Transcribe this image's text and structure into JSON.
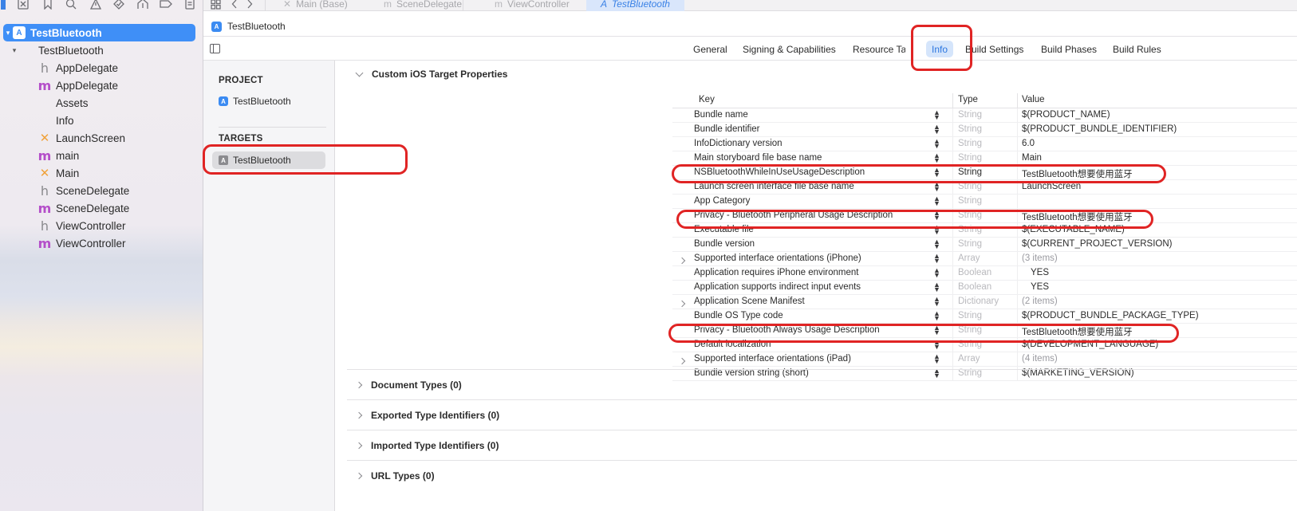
{
  "colors": {
    "accent": "#3f8ff7",
    "annotation": "#e02424",
    "selected_tab_bg": "#d5e5fb"
  },
  "navigator": {
    "toolbar_icons": [
      "project-navigator-icon",
      "source-control-icon",
      "bookmark-icon",
      "find-icon",
      "issue-icon",
      "test-icon",
      "debug-icon",
      "breakpoint-icon",
      "report-icon"
    ],
    "tree": [
      {
        "label": "TestBluetooth",
        "type": "proj",
        "glyph": "A",
        "level": 0,
        "disclosure": "▾",
        "selected": true
      },
      {
        "label": "TestBluetooth",
        "type": "folder",
        "glyph": "",
        "level": 1,
        "disclosure": "▾",
        "selected": false
      },
      {
        "label": "AppDelegate",
        "type": "h",
        "glyph": "h",
        "level": 2,
        "disclosure": "",
        "selected": false
      },
      {
        "label": "AppDelegate",
        "type": "m",
        "glyph": "m",
        "level": 2,
        "disclosure": "",
        "selected": false
      },
      {
        "label": "Assets",
        "type": "assets",
        "glyph": "",
        "level": 2,
        "disclosure": "",
        "selected": false
      },
      {
        "label": "Info",
        "type": "plist",
        "glyph": "",
        "level": 2,
        "disclosure": "",
        "selected": false
      },
      {
        "label": "LaunchScreen",
        "type": "xib",
        "glyph": "✕",
        "level": 2,
        "disclosure": "",
        "selected": false
      },
      {
        "label": "main",
        "type": "m",
        "glyph": "m",
        "level": 2,
        "disclosure": "",
        "selected": false
      },
      {
        "label": "Main",
        "type": "xib",
        "glyph": "✕",
        "level": 2,
        "disclosure": "",
        "selected": false
      },
      {
        "label": "SceneDelegate",
        "type": "h",
        "glyph": "h",
        "level": 2,
        "disclosure": "",
        "selected": false
      },
      {
        "label": "SceneDelegate",
        "type": "m",
        "glyph": "m",
        "level": 2,
        "disclosure": "",
        "selected": false
      },
      {
        "label": "ViewController",
        "type": "h",
        "glyph": "h",
        "level": 2,
        "disclosure": "",
        "selected": false
      },
      {
        "label": "ViewController",
        "type": "m",
        "glyph": "m",
        "level": 2,
        "disclosure": "",
        "selected": false
      }
    ]
  },
  "editor_tabs": [
    {
      "label": "Main (Base)",
      "glyph": "✕",
      "active": false
    },
    {
      "label": "SceneDelegate",
      "glyph": "m",
      "active": false
    },
    {
      "label": "ViewController",
      "glyph": "m",
      "active": false
    },
    {
      "label": "TestBluetooth",
      "glyph": "A",
      "active": true
    }
  ],
  "breadcrumb": {
    "label": "TestBluetooth",
    "glyph": "A"
  },
  "top_tabs": [
    {
      "label": "General",
      "active": false
    },
    {
      "label": "Signing & Capabilities",
      "active": false
    },
    {
      "label": "Resource Tags",
      "active": false
    },
    {
      "label": "Info",
      "active": true
    },
    {
      "label": "Build Settings",
      "active": false
    },
    {
      "label": "Build Phases",
      "active": false
    },
    {
      "label": "Build Rules",
      "active": false
    }
  ],
  "sidebar": {
    "project_heading": "PROJECT",
    "project_item": "TestBluetooth",
    "project_glyph": "A",
    "targets_heading": "TARGETS",
    "target_item": "TestBluetooth",
    "target_glyph": "A"
  },
  "custom_properties": {
    "title": "Custom iOS Target Properties",
    "columns": {
      "key": "Key",
      "type": "Type",
      "value": "Value"
    },
    "rows": [
      {
        "key": "Bundle name",
        "type": "String",
        "value": "$(PRODUCT_NAME)",
        "expandable": false
      },
      {
        "key": "Bundle identifier",
        "type": "String",
        "value": "$(PRODUCT_BUNDLE_IDENTIFIER)",
        "expandable": false
      },
      {
        "key": "InfoDictionary version",
        "type": "String",
        "value": "6.0",
        "expandable": false
      },
      {
        "key": "Main storyboard file base name",
        "type": "String",
        "value": "Main",
        "expandable": false
      },
      {
        "key": "NSBluetoothWhileInUseUsageDescription",
        "type": "String",
        "value": "TestBluetooth想要使用蓝牙",
        "expandable": false,
        "type_strong": true
      },
      {
        "key": "Launch screen interface file base name",
        "type": "String",
        "value": "LaunchScreen",
        "expandable": false
      },
      {
        "key": "App Category",
        "type": "String",
        "value": "",
        "expandable": false,
        "value_stepper": true
      },
      {
        "key": "Privacy - Bluetooth Peripheral Usage Description",
        "type": "String",
        "value": "TestBluetooth想要使用蓝牙",
        "expandable": false
      },
      {
        "key": "Executable file",
        "type": "String",
        "value": "$(EXECUTABLE_NAME)",
        "expandable": false
      },
      {
        "key": "Bundle version",
        "type": "String",
        "value": "$(CURRENT_PROJECT_VERSION)",
        "expandable": false
      },
      {
        "key": "Supported interface orientations (iPhone)",
        "type": "Array",
        "value": "(3 items)",
        "expandable": true,
        "value_muted": true
      },
      {
        "key": "Application requires iPhone environment",
        "type": "Boolean",
        "value": "YES",
        "expandable": false,
        "value_stepper": true,
        "value_indent": true
      },
      {
        "key": "Application supports indirect input events",
        "type": "Boolean",
        "value": "YES",
        "expandable": false,
        "value_stepper": true,
        "value_indent": true
      },
      {
        "key": "Application Scene Manifest",
        "type": "Dictionary",
        "value": "(2 items)",
        "expandable": true,
        "value_muted": true
      },
      {
        "key": "Bundle OS Type code",
        "type": "String",
        "value": "$(PRODUCT_BUNDLE_PACKAGE_TYPE)",
        "expandable": false
      },
      {
        "key": "Privacy - Bluetooth Always Usage Description",
        "type": "String",
        "value": "TestBluetooth想要使用蓝牙",
        "expandable": false
      },
      {
        "key": "Default localization",
        "type": "String",
        "value": "$(DEVELOPMENT_LANGUAGE)",
        "expandable": false
      },
      {
        "key": "Supported interface orientations (iPad)",
        "type": "Array",
        "value": "(4 items)",
        "expandable": true,
        "value_muted": true
      },
      {
        "key": "Bundle version string (short)",
        "type": "String",
        "value": "$(MARKETING_VERSION)",
        "expandable": false
      }
    ]
  },
  "sections": [
    {
      "label": "Document Types (0)"
    },
    {
      "label": "Exported Type Identifiers (0)"
    },
    {
      "label": "Imported Type Identifiers (0)"
    },
    {
      "label": "URL Types (0)"
    }
  ]
}
